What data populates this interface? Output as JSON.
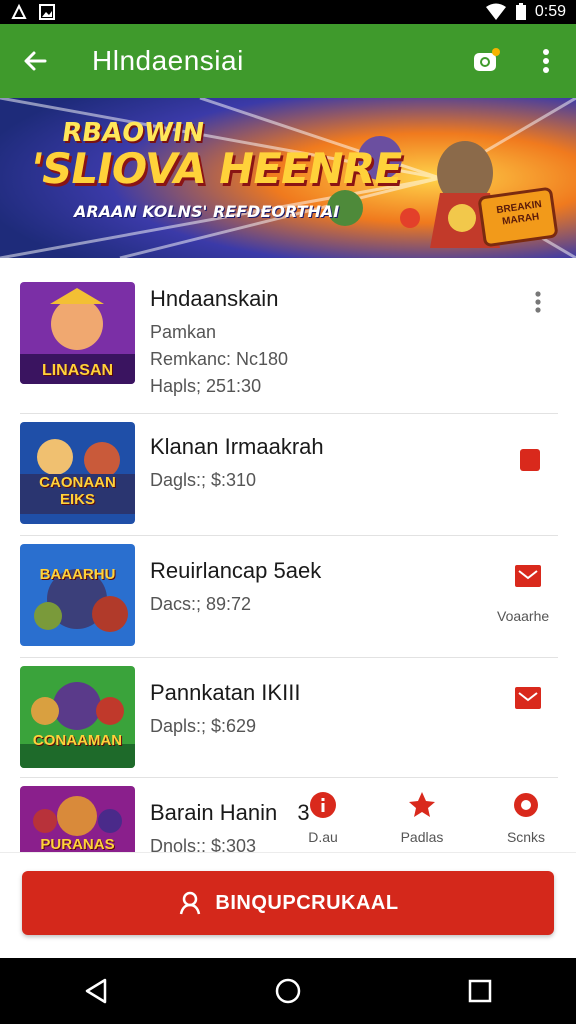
{
  "status_bar": {
    "time": "0:59"
  },
  "app_bar": {
    "title": "Hlndaensiai"
  },
  "banner": {
    "line1": "RBAOWIN",
    "line2": "'SLIOVA HEENRE",
    "line3": "ARAAN KOLNS' REFDEORTHAI",
    "badge": "BREAKIN MARAH"
  },
  "list": {
    "items": [
      {
        "title": "Hndaanskain",
        "lines": [
          "Pamkan",
          "Remkanc: Nc180",
          "Hapls; 251:30"
        ],
        "thumb_text": "LINASAN",
        "accent": "#7b2fa6"
      },
      {
        "title": "Klanan Irmaakrah",
        "lines": [
          "Dagls:; $:310"
        ],
        "thumb_text": "CAONAAN EIKS",
        "accent": "#1f4fa8"
      },
      {
        "title": "Reuirlancap 5aek",
        "lines": [
          "Dacs:; 89:72"
        ],
        "thumb_text": "BAAARHU",
        "accent": "#2a6fcf",
        "action_label": "Voaarhe"
      },
      {
        "title": "Pannkatan IKIII",
        "lines": [
          "Dapls:; $:629"
        ],
        "thumb_text": "CONAAMAN",
        "accent": "#3aa33b"
      },
      {
        "title": "Barain Hanin",
        "lines": [
          "Dnols:; $:303"
        ],
        "thumb_text": "PURANAS",
        "accent": "#8a1f8c",
        "title_suffix": "3"
      }
    ]
  },
  "bottom_actions": [
    {
      "label": "D.au"
    },
    {
      "label": "Padlas"
    },
    {
      "label": "Scnks"
    }
  ],
  "cta": {
    "label": "BINQUPCRUKAAL"
  },
  "colors": {
    "app_bar": "#3f9a2c",
    "cta": "#d4281b",
    "accent_red": "#d9291c"
  }
}
